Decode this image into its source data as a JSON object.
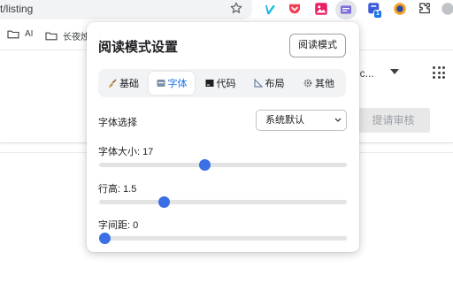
{
  "browser": {
    "url_fragment": "t/listing",
    "star_icon": "bookmark-star-icon",
    "extensions": [
      "vimeo-icon",
      "pocket-icon",
      "image-icon",
      "reader-mode-icon",
      "extension-badge-icon",
      "avatar-icon",
      "puzzle-icon"
    ],
    "badge_count": "1"
  },
  "bookmarks": [
    {
      "label": "AI",
      "icon": "folder-icon"
    },
    {
      "label": "长夜烛",
      "icon": "folder-icon"
    }
  ],
  "site": {
    "account_label": "il.c...",
    "review_button": "提请审核"
  },
  "popup": {
    "title": "阅读模式设置",
    "reader_button": "阅读模式",
    "tabs": [
      {
        "label": "基础",
        "icon": "brush-icon"
      },
      {
        "label": "字体",
        "icon": "font-icon"
      },
      {
        "label": "代码",
        "icon": "terminal-icon"
      },
      {
        "label": "布局",
        "icon": "ruler-icon"
      },
      {
        "label": "其他",
        "icon": "gear-icon"
      }
    ],
    "active_tab": "字体",
    "font_select": {
      "label": "字体选择",
      "value": "系统默认"
    },
    "sliders": [
      {
        "label": "字体大小:",
        "value": "17",
        "fraction": 0.42
      },
      {
        "label": "行高:",
        "value": "1.5",
        "fraction": 0.25
      },
      {
        "label": "字间距:",
        "value": "0",
        "fraction": 0.0
      }
    ]
  },
  "colors": {
    "accent": "#3a6fe6",
    "link_blue": "#1a73e8"
  }
}
